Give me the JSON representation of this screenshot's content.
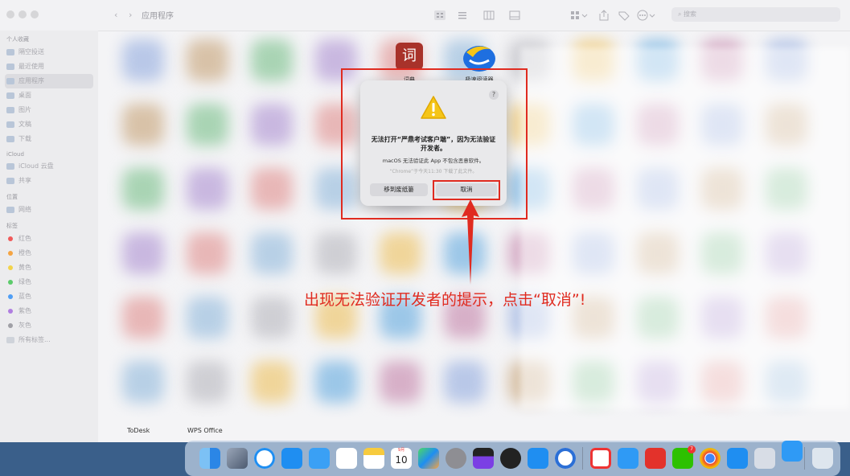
{
  "window": {
    "title": "应用程序",
    "nav": {
      "back": "‹",
      "forward": "›"
    },
    "search_placeholder": "搜索"
  },
  "sidebar": {
    "sections": [
      {
        "title": "个人收藏",
        "items": [
          {
            "label": "隔空投送",
            "icon": "airdrop-icon"
          },
          {
            "label": "最近使用",
            "icon": "clock-icon"
          },
          {
            "label": "应用程序",
            "icon": "applications-icon",
            "active": true
          },
          {
            "label": "桌面",
            "icon": "desktop-icon"
          },
          {
            "label": "图片",
            "icon": "pictures-icon"
          },
          {
            "label": "文稿",
            "icon": "document-icon"
          },
          {
            "label": "下载",
            "icon": "download-icon"
          }
        ]
      },
      {
        "title": "iCloud",
        "items": [
          {
            "label": "iCloud 云盘",
            "icon": "cloud-icon"
          },
          {
            "label": "共享",
            "icon": "shared-folder-icon"
          }
        ]
      },
      {
        "title": "位置",
        "items": [
          {
            "label": "网络",
            "icon": "network-icon"
          }
        ]
      },
      {
        "title": "标签",
        "items": [
          {
            "label": "红色",
            "color": "#f05a5a"
          },
          {
            "label": "橙色",
            "color": "#f5a442"
          },
          {
            "label": "黄色",
            "color": "#f2d34a"
          },
          {
            "label": "绿色",
            "color": "#5ccb6b"
          },
          {
            "label": "蓝色",
            "color": "#4f9ef5"
          },
          {
            "label": "紫色",
            "color": "#b07ee0"
          },
          {
            "label": "灰色",
            "color": "#a0a0a6"
          },
          {
            "label": "所有标签...",
            "icon": "tags-icon"
          }
        ]
      }
    ]
  },
  "apps": {
    "dictionary_label": "词典",
    "dictionary_glyph": "词",
    "reader_label": "极速阅读器",
    "bottom_labels": [
      "ToDesk",
      "WPS Office"
    ]
  },
  "dialog": {
    "help": "?",
    "title": "无法打开“严鼎考试客户端”，因为无法验证开发者。",
    "message": "macOS 无法验证此 App 不包含恶意软件。",
    "note": "“Chrome”于今天11:30 下载了此文件。",
    "trash_button": "移到废纸篓",
    "cancel_button": "取消"
  },
  "annotation": {
    "text": "出现无法验证开发者的提示，点击“取消”!",
    "color": "#e02b20"
  },
  "dock": {
    "calendar_month": "9月",
    "calendar_day": "10",
    "notification_badge": "7"
  }
}
